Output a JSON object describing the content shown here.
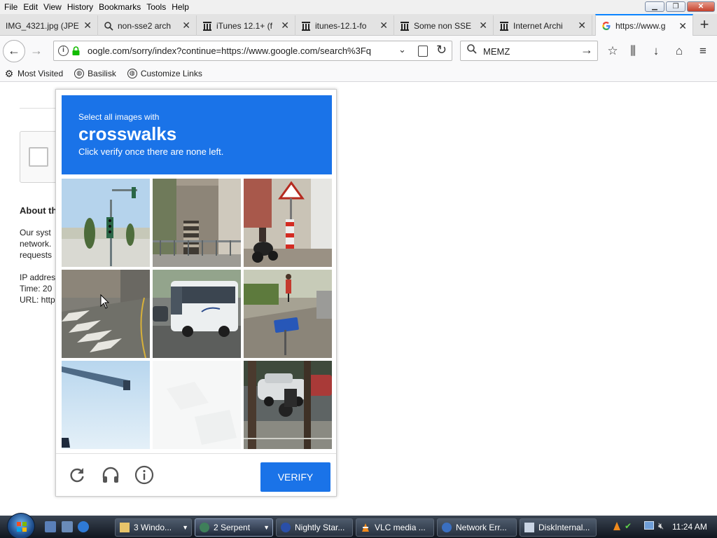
{
  "menubar": {
    "items": [
      "File",
      "Edit",
      "View",
      "History",
      "Bookmarks",
      "Tools",
      "Help"
    ]
  },
  "window_controls": [
    "minimize",
    "restore",
    "close"
  ],
  "tabs": [
    {
      "label": "IMG_4321.jpg (JPE",
      "icon": "file-icon"
    },
    {
      "label": "non-sse2 arch",
      "icon": "search-icon"
    },
    {
      "label": "iTunes 12.1+ (f",
      "icon": "archive-icon"
    },
    {
      "label": "itunes-12.1-fo",
      "icon": "archive-icon"
    },
    {
      "label": "Some non SSE",
      "icon": "archive-icon"
    },
    {
      "label": "Internet Archi",
      "icon": "archive-icon"
    },
    {
      "label": "https://www.g",
      "icon": "google-icon",
      "active": true
    }
  ],
  "navbar": {
    "url": "oogle.com/sorry/index?continue=https://www.google.com/search%3Fq",
    "search_value": "MEMZ"
  },
  "bookmarks": [
    {
      "label": "Most Visited",
      "icon": "gear-icon"
    },
    {
      "label": "Basilisk",
      "icon": "globe-icon"
    },
    {
      "label": "Customize Links",
      "icon": "globe-icon"
    }
  ],
  "page": {
    "about_heading": "About th",
    "body_lines": [
      "Our syst",
      "network.",
      "requests"
    ],
    "ip_lines": [
      "IP addres",
      "Time: 20",
      "URL: http"
    ]
  },
  "captcha": {
    "instruction": "Select all images with",
    "target": "crosswalks",
    "hint": "Click verify once there are none left.",
    "verify_label": "VERIFY",
    "tiles": [
      "traffic-light-tile",
      "stairs-tile",
      "motorcycle-sign-tile",
      "crosswalk-tile",
      "bus-tile",
      "cyclist-sign-tile",
      "crane-tile",
      "blank-tile",
      "car-motorcycle-tile"
    ]
  },
  "taskbar": {
    "buttons": [
      {
        "label": "3 Windo...",
        "icon": "folder-icon",
        "dropdown": true
      },
      {
        "label": "2 Serpent",
        "icon": "serpent-icon",
        "dropdown": true,
        "active": true
      },
      {
        "label": "Nightly Star...",
        "icon": "globe-icon"
      },
      {
        "label": "VLC media ...",
        "icon": "vlc-icon"
      },
      {
        "label": "Network Err...",
        "icon": "network-icon"
      },
      {
        "label": "DiskInternal...",
        "icon": "disk-icon"
      }
    ],
    "clock": "11:24 AM"
  },
  "colors": {
    "captcha_blue": "#1a73e8",
    "tab_accent": "#0a84ff"
  }
}
